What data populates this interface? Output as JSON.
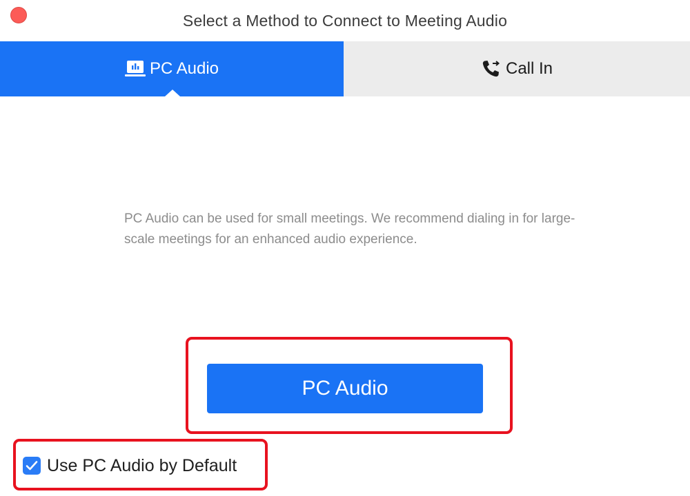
{
  "window": {
    "title": "Select a Method to Connect to Meeting Audio"
  },
  "tabs": [
    {
      "label": "PC Audio",
      "icon": "pc-audio-icon",
      "selected": true
    },
    {
      "label": "Call In",
      "icon": "phone-transfer-icon",
      "selected": false
    }
  ],
  "main": {
    "description": "PC Audio can be used for small meetings. We recommend dialing in for large-scale meetings for an enhanced audio experience.",
    "button_label": "PC Audio"
  },
  "default_option": {
    "label": "Use PC Audio by Default",
    "checked": true
  },
  "colors": {
    "accent": "#1a73f5",
    "highlight": "#e8121f",
    "close": "#fc5b57",
    "inactive_tab": "#ececec"
  }
}
